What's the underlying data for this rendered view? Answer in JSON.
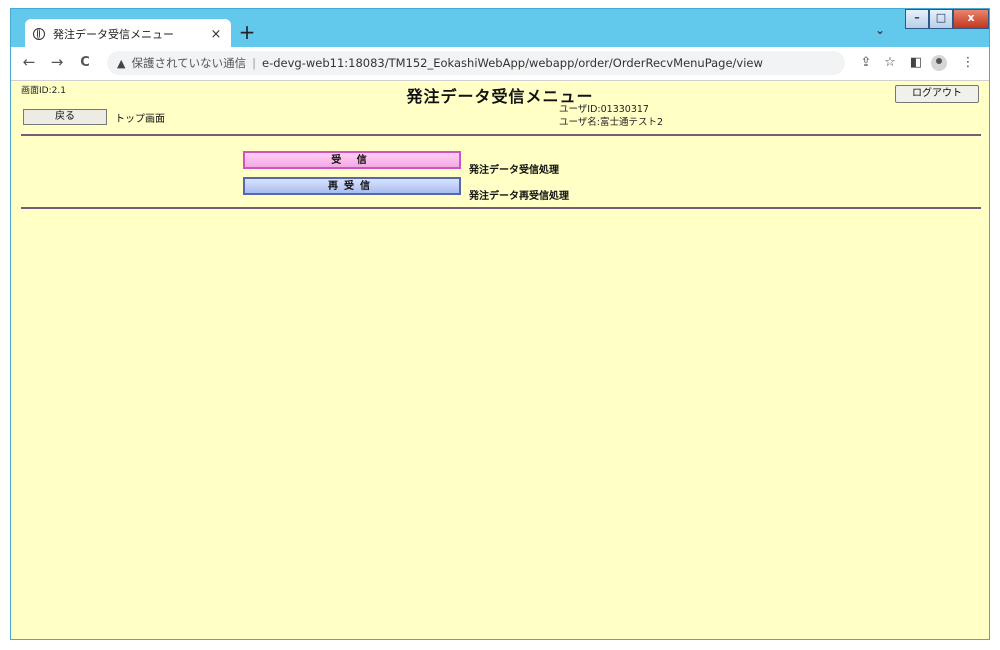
{
  "browser": {
    "tab_title": "発注データ受信メニュー",
    "tab_close": "×",
    "new_tab": "+",
    "tab_search": "⌄",
    "window_controls": {
      "minimize": "–",
      "maximize": "□",
      "close": "x"
    },
    "nav": {
      "back": "←",
      "forward": "→",
      "reload": "C"
    },
    "security_warning": "保護されていない通信",
    "separator": "|",
    "url": "e-devg-web11:18083/TM152_EokashiWebApp/webapp/order/OrderRecvMenuPage/view",
    "toolbar_icons": {
      "share": "⇪",
      "bookmark": "☆",
      "side_panel": "◧",
      "menu": "⋮"
    }
  },
  "page": {
    "screen_id": "画面ID:2.1",
    "title": "発注データ受信メニュー",
    "logout_label": "ログアウト",
    "back_label": "戻る",
    "top_label": "トップ画面",
    "user_id": "ユーザID:01330317",
    "user_name": "ユーザ名:富士通テスト2",
    "menu": [
      {
        "label": "受 信",
        "description": "発注データ受信処理"
      },
      {
        "label": "再受信",
        "description": "発注データ再受信処理"
      }
    ]
  }
}
